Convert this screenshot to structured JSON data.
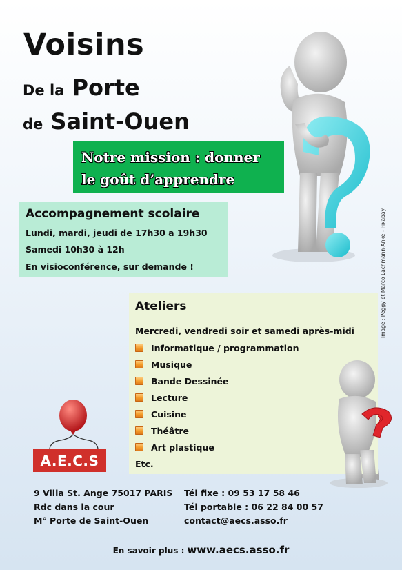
{
  "title": {
    "line1": "Voisins",
    "line2_small": "De la",
    "line2_big": "Porte",
    "line3_small": "de",
    "line3_big": "Saint-Ouen"
  },
  "mission": {
    "line1": "Notre mission : donner",
    "line2": "le goût d’apprendre"
  },
  "accompagnement": {
    "title": "Accompagnement scolaire",
    "lines": [
      "Lundi, mardi, jeudi de 17h30 a 19h30",
      "Samedi 10h30 à 12h",
      "En visioconférence, sur demande !"
    ]
  },
  "ateliers": {
    "title": "Ateliers",
    "subtitle": "Mercredi, vendredi soir et samedi après-midi",
    "items": [
      "Informatique / programmation",
      "Musique",
      "Bande Dessinée",
      "Lecture",
      "Cuisine",
      "Théâtre",
      "Art plastique"
    ],
    "etc": "Etc."
  },
  "logo": {
    "text": "A.E.C.S"
  },
  "address": [
    "9 Villa St. Ange 75017 PARIS",
    "Rdc dans la cour",
    "M° Porte de Saint-Ouen"
  ],
  "contact": [
    "Tél fixe : 09 53 17 58 46",
    "Tél portable : 06 22 84 00 57",
    "contact@aecs.asso.fr"
  ],
  "more": {
    "label": "En savoir plus :",
    "url": "www.aecs.asso.fr"
  },
  "credit": "Image : Peggy et Marco Lachmann-Anke - Pixabay",
  "colors": {
    "mission_bg": "#0fb14f",
    "accomp_bg": "#b9ecd6",
    "ateliers_bg": "#edf4d9",
    "logo_red": "#d0302b",
    "question_cyan": "#3fd3df",
    "question_red": "#e0262b"
  },
  "icons": [
    "thinking-figure-illustration",
    "red-balloon-icon",
    "bullet-square-icon",
    "reading-figure-illustration"
  ]
}
